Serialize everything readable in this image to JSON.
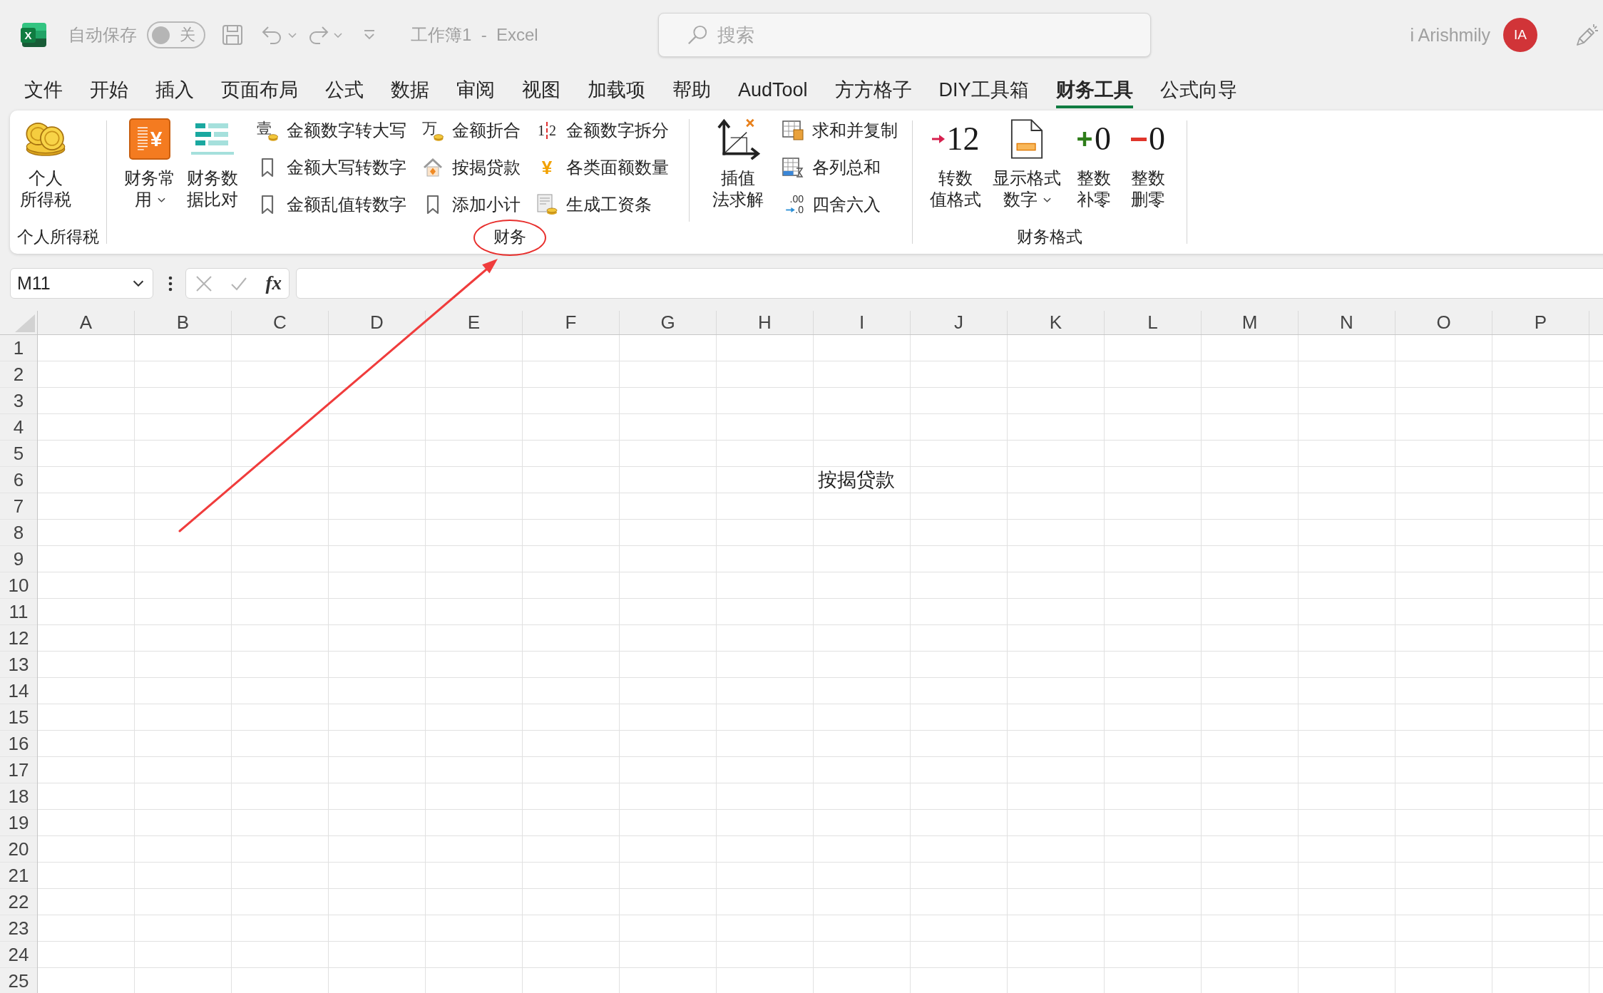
{
  "title_bar": {
    "logo_letter": "X",
    "autosave_label": "自动保存",
    "autosave": {
      "on": false,
      "text": "关"
    },
    "title": "工作簿1  -  Excel",
    "search": {
      "placeholder": "搜索"
    },
    "user_name": "i Arishmily",
    "avatar_initials": "IA"
  },
  "tabs": [
    {
      "label": "文件",
      "selected": false
    },
    {
      "label": "开始",
      "selected": false
    },
    {
      "label": "插入",
      "selected": false
    },
    {
      "label": "页面布局",
      "selected": false
    },
    {
      "label": "公式",
      "selected": false
    },
    {
      "label": "数据",
      "selected": false
    },
    {
      "label": "审阅",
      "selected": false
    },
    {
      "label": "视图",
      "selected": false
    },
    {
      "label": "加载项",
      "selected": false
    },
    {
      "label": "帮助",
      "selected": false
    },
    {
      "label": "AudTool",
      "selected": false
    },
    {
      "label": "方方格子",
      "selected": false
    },
    {
      "label": "DIY工具箱",
      "selected": false
    },
    {
      "label": "财务工具",
      "selected": true
    },
    {
      "label": "公式向导",
      "selected": false
    }
  ],
  "ribbon": {
    "groups": [
      {
        "label": "个人所得税",
        "circled": false,
        "items": [
          {
            "kind": "large",
            "lines": [
              "个人",
              "所得税"
            ],
            "dropdown": false
          }
        ]
      },
      {
        "label": "财务",
        "circled": true,
        "items": [
          {
            "kind": "large",
            "glyph": [
              "¥"
            ],
            "lines": [
              "财务常",
              "用"
            ],
            "dropdown": true
          },
          {
            "kind": "large",
            "lines": [
              "财务数",
              "据比对"
            ],
            "dropdown": false
          },
          {
            "kind": "stack",
            "buttons": [
              {
                "glyph": [
                  "壹"
                ],
                "label": "金额数字转大写"
              },
              {
                "label": "金额大写转数字"
              },
              {
                "label": "金额乱值转数字"
              }
            ]
          },
          {
            "kind": "stack",
            "buttons": [
              {
                "glyph": [
                  "万"
                ],
                "label": "金额折合"
              },
              {
                "label": "按揭贷款"
              },
              {
                "label": "添加小计"
              }
            ]
          },
          {
            "kind": "stack",
            "buttons": [
              {
                "glyph": [
                  "1",
                  "2"
                ],
                "label": "金额数字拆分"
              },
              {
                "glyph": [
                  "¥"
                ],
                "label": "各类面额数量"
              },
              {
                "label": "生成工资条"
              }
            ]
          },
          {
            "kind": "separator"
          },
          {
            "kind": "large",
            "lines": [
              "插值",
              "法求解"
            ],
            "dropdown": false
          },
          {
            "kind": "stack",
            "buttons": [
              {
                "label": "求和并复制"
              },
              {
                "label": "各列总和"
              },
              {
                "glyph": [
                  ".00",
                  ".0"
                ],
                "label": "四舍六入"
              }
            ]
          }
        ]
      },
      {
        "label": "财务格式",
        "circled": false,
        "items": [
          {
            "kind": "large",
            "glyph": [
              "12"
            ],
            "lines": [
              "转数",
              "值格式"
            ],
            "dropdown": false
          },
          {
            "kind": "large",
            "lines": [
              "显示格式",
              "数字"
            ],
            "dropdown": true
          },
          {
            "kind": "large",
            "glyph": [
              "0"
            ],
            "lines": [
              "整数",
              "补零"
            ],
            "dropdown": false
          },
          {
            "kind": "large",
            "glyph": [
              "0"
            ],
            "lines": [
              "整数",
              "删零"
            ],
            "dropdown": false
          }
        ]
      }
    ]
  },
  "formula_bar": {
    "name_box": "M11",
    "cancel": {
      "disabled": true
    },
    "enter": {
      "disabled": true
    },
    "function_label": "fx"
  },
  "sheet": {
    "columns": [
      "A",
      "B",
      "C",
      "D",
      "E",
      "F",
      "G",
      "H",
      "I",
      "J",
      "K",
      "L",
      "M",
      "N",
      "O",
      "P"
    ],
    "rows": [
      "1",
      "2",
      "3",
      "4",
      "5",
      "6",
      "7",
      "8",
      "9",
      "10",
      "11",
      "12",
      "13",
      "14",
      "15",
      "16",
      "17",
      "18",
      "19",
      "20",
      "21",
      "22",
      "23",
      "24",
      "25"
    ],
    "cells": [
      {
        "value": "按揭贷款"
      }
    ]
  },
  "annotations": [
    {
      "kind": "arrow"
    }
  ]
}
